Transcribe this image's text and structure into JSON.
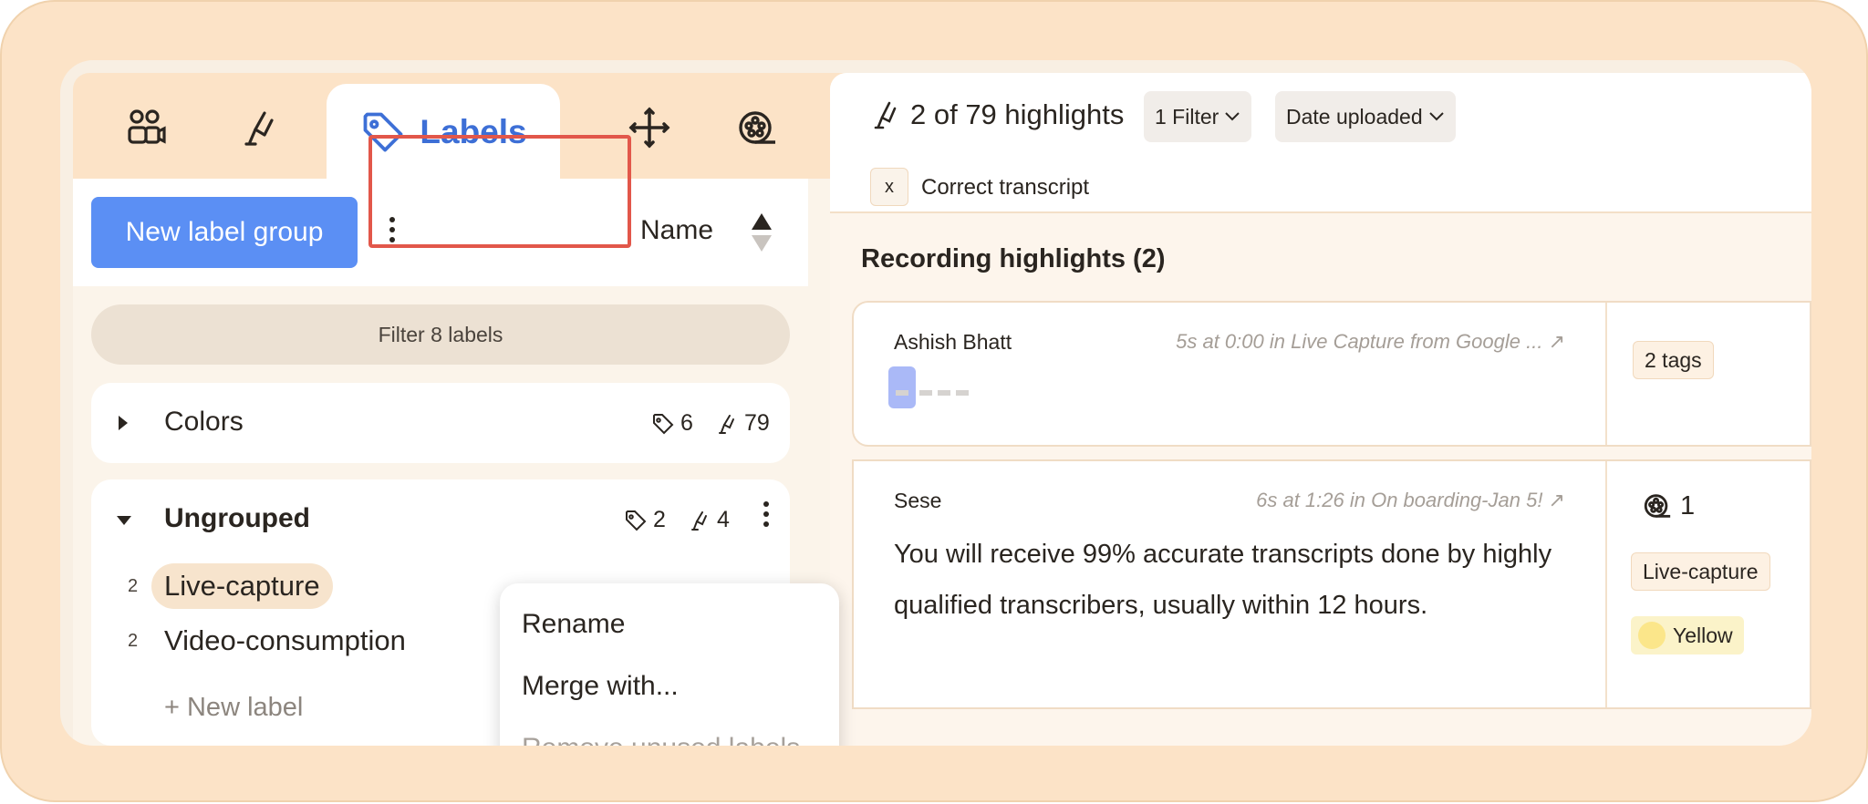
{
  "tabs": {
    "people_icon": "people-icon",
    "highlighter_icon": "highlighter-icon",
    "labels_label": "Labels",
    "add_icon": "plus-icon",
    "reel_icon": "film-reel-icon",
    "active_color": "#3d6fd6"
  },
  "toolbar": {
    "new_group_label": "New label group",
    "sort_label": "Name"
  },
  "filter": {
    "placeholder": "Filter 8 labels"
  },
  "groups": [
    {
      "name": "Colors",
      "label_count": "6",
      "highlight_count": "79",
      "expanded": false
    },
    {
      "name": "Ungrouped",
      "label_count": "2",
      "highlight_count": "4",
      "expanded": true,
      "labels": [
        {
          "count": "2",
          "name": "Live-capture",
          "selected": true
        },
        {
          "count": "2",
          "name": "Video-consumption",
          "selected": false
        }
      ],
      "new_label": "+ New label"
    }
  ],
  "context_menu": {
    "items": [
      {
        "label": "Rename",
        "enabled": true
      },
      {
        "label": "Merge with...",
        "enabled": true
      },
      {
        "label": "Remove unused labels",
        "enabled": false
      }
    ]
  },
  "highlights_header": {
    "count_text": "2 of 79 highlights",
    "filter_button": "1 Filter",
    "sort_button": "Date uploaded",
    "active_filter": {
      "remove": "x",
      "label": "Correct transcript"
    }
  },
  "section": {
    "title": "Recording highlights (2)"
  },
  "highlights": [
    {
      "author": "Ashish Bhatt",
      "meta": "5s at 0:00 in Live Capture from Google ... ↗",
      "text": "",
      "side": {
        "tags": "2 tags"
      }
    },
    {
      "author": "Sese",
      "meta": "6s at 1:26 in On boarding-Jan 5! ↗",
      "text": "You will receive 99% accurate transcripts done by highly qualified transcribers, usually within 12 hours.",
      "side": {
        "reel_count": "1",
        "tag1": "Live-capture",
        "tag2": "Yellow",
        "tag2_color": "#fbe68a"
      }
    }
  ],
  "colors": {
    "accent": "#5b8ff4",
    "highlight_box": "#e2574a",
    "frame": "#fce3c7"
  }
}
